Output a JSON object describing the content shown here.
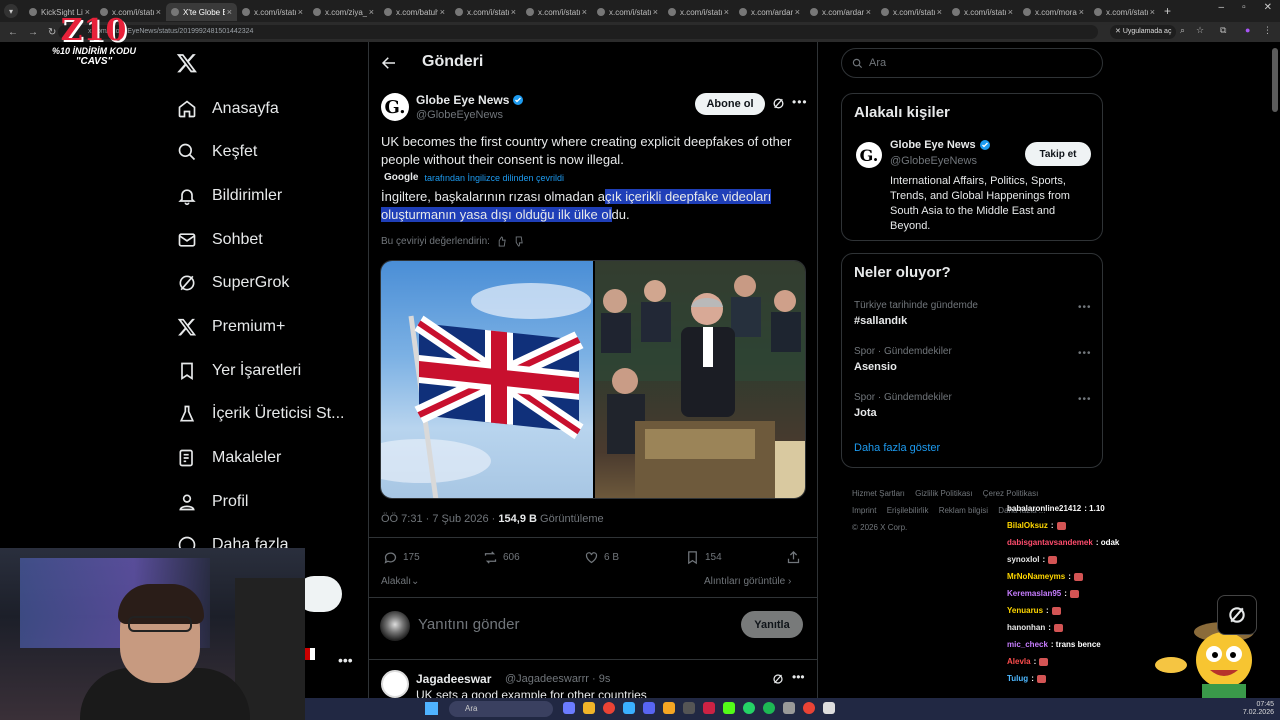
{
  "browser": {
    "tabs": [
      {
        "label": "KickSight Live"
      },
      {
        "label": "x.com/i/status"
      },
      {
        "label": "X'te Globe Eye"
      },
      {
        "label": "x.com/i/status"
      },
      {
        "label": "x.com/ziya_o"
      },
      {
        "label": "x.com/batuhan"
      },
      {
        "label": "x.com/i/status"
      },
      {
        "label": "x.com/i/status"
      },
      {
        "label": "x.com/i/status"
      },
      {
        "label": "x.com/i/status"
      },
      {
        "label": "x.com/ardanz"
      },
      {
        "label": "x.com/ardanz"
      },
      {
        "label": "x.com/i/status"
      },
      {
        "label": "x.com/i/status"
      },
      {
        "label": "x.com/moram"
      },
      {
        "label": "x.com/i/status"
      }
    ],
    "url": "x.com/GlobeEyeNews/status/2019992481501442324",
    "app_button": "Uygulamada aç"
  },
  "overlay_logo": {
    "brand": "Z10",
    "promo_line1": "%10 İNDİRİM KODU",
    "promo_line2": "\"CAVS\""
  },
  "sidebar": {
    "items": [
      {
        "label": "Anasayfa",
        "icon": "home-icon"
      },
      {
        "label": "Keşfet",
        "icon": "search-icon"
      },
      {
        "label": "Bildirimler",
        "icon": "bell-icon"
      },
      {
        "label": "Sohbet",
        "icon": "mail-icon"
      },
      {
        "label": "SuperGrok",
        "icon": "grok-icon"
      },
      {
        "label": "Premium+",
        "icon": "x-icon"
      },
      {
        "label": "Yer İşaretleri",
        "icon": "bookmark-icon"
      },
      {
        "label": "İçerik Üreticisi St...",
        "icon": "flask-icon"
      },
      {
        "label": "Makaleler",
        "icon": "article-icon"
      },
      {
        "label": "Profil",
        "icon": "person-icon"
      },
      {
        "label": "Daha fazla",
        "icon": "more-circle-icon"
      }
    ]
  },
  "header": {
    "title": "Gönderi"
  },
  "post": {
    "author_name": "Globe Eye News",
    "author_handle": "@GlobeEyeNews",
    "subscribe_label": "Abone ol",
    "text": "UK becomes the first country where creating explicit deepfakes of other people without their consent is now illegal.",
    "translation_brand": "Google",
    "translation_note": "tarafından İngilizce dilinden çevrildi",
    "translated_part1": "İngiltere, başkalarının rızası olmadan a",
    "translated_part2": "çık içerikli deepfake videoları oluşturmanın yasa dışı olduğu ilk ülke ol",
    "translated_part3": "du.",
    "rate_translation": "Bu çeviriyi değerlendirin:",
    "time": "ÖÖ 7:31 · 7 Şub 2026 ·",
    "views_count": "154,9 B",
    "views_label": "Görüntüleme",
    "replies": "175",
    "reposts": "606",
    "likes": "6 B",
    "bookmarks": "154",
    "related_label": "Alakalı",
    "quotes_label": "Alıntıları görüntüle"
  },
  "reply_box": {
    "placeholder": "Yanıtını gönder",
    "button": "Yanıtla"
  },
  "reply": {
    "name": "Jagadeeswar",
    "handle": "@Jagadeeswarrr · 9s",
    "text": "UK sets a good example for other countries"
  },
  "right": {
    "search_placeholder": "Ara",
    "related_title": "Alakalı kişiler",
    "related_name": "Globe Eye News",
    "related_handle": "@GlobeEyeNews",
    "follow_label": "Takip et",
    "related_bio": "International Affairs, Politics, Sports, Trends, and Global Happenings from South Asia to the Middle East and Beyond.",
    "trends_title": "Neler oluyor?",
    "trends": [
      {
        "meta": "Türkiye tarihinde gündemde",
        "name": "#sallandık"
      },
      {
        "meta": "Spor · Gündemdekiler",
        "name": "Asensio"
      },
      {
        "meta": "Spor · Gündemdekiler",
        "name": "Jota"
      }
    ],
    "show_more": "Daha fazla göster",
    "footer_links": [
      "Hizmet Şartları",
      "Gizlilik Politikası",
      "Çerez Politikası",
      "Imprint",
      "Erişilebilirlik",
      "Reklam bilgisi",
      "Daha fazla ..."
    ],
    "copyright": "© 2026 X Corp."
  },
  "chat": {
    "messages": [
      {
        "user": "babalaronline21412",
        "msg": ": 1.10",
        "color": "#f5f5f5",
        "emote": false
      },
      {
        "user": "BilalOksuz",
        "msg": ":",
        "color": "#ffd700",
        "emote": true
      },
      {
        "user": "dabisgantavsandemek",
        "msg": ": odak",
        "color": "#ff4d6d",
        "emote": false
      },
      {
        "user": "synoxlol",
        "msg": ":",
        "color": "#e8e8e8",
        "emote": true
      },
      {
        "user": "MrNoNameyms",
        "msg": ":",
        "color": "#ffd700",
        "emote": true
      },
      {
        "user": "Keremaslan95",
        "msg": ":",
        "color": "#c77dff",
        "emote": true
      },
      {
        "user": "Yenuarus",
        "msg": ":",
        "color": "#ffd700",
        "emote": true
      },
      {
        "user": "hanonhan",
        "msg": ":",
        "color": "#e8e8e8",
        "emote": true
      },
      {
        "user": "mic_check",
        "msg": ": trans bence",
        "color": "#c77dff",
        "emote": false
      },
      {
        "user": "Alevla",
        "msg": ":",
        "color": "#ff4d4d",
        "emote": true
      },
      {
        "user": "Tulug",
        "msg": ":",
        "color": "#4db8ff",
        "emote": true
      }
    ]
  },
  "taskbar": {
    "search": "Ara",
    "time": "07:45",
    "date": "7.02.2026"
  }
}
